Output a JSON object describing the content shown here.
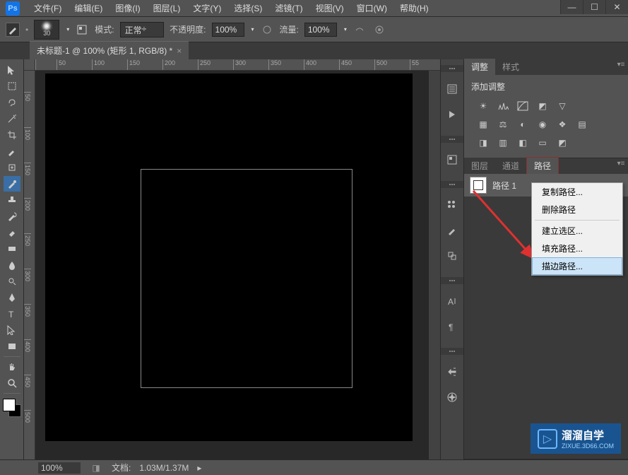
{
  "app": {
    "logo_text": "Ps"
  },
  "menubar": [
    "文件(F)",
    "编辑(E)",
    "图像(I)",
    "图层(L)",
    "文字(Y)",
    "选择(S)",
    "滤镜(T)",
    "视图(V)",
    "窗口(W)",
    "帮助(H)"
  ],
  "window_controls": {
    "minimize": "—",
    "maximize": "☐",
    "close": "✕"
  },
  "options_bar": {
    "brush_size": "30",
    "mode_label": "模式:",
    "mode_value": "正常",
    "opacity_label": "不透明度:",
    "opacity_value": "100%",
    "flow_label": "流量:",
    "flow_value": "100%"
  },
  "document": {
    "tab_title": "未标题-1 @ 100% (矩形 1, RGB/8) *",
    "close": "×"
  },
  "ruler_h": [
    "50",
    "100",
    "150",
    "200",
    "250",
    "300",
    "350",
    "400",
    "450",
    "500",
    "55"
  ],
  "ruler_v": [
    "50",
    "100",
    "150",
    "200",
    "250",
    "300",
    "350",
    "400",
    "450",
    "500"
  ],
  "panels": {
    "adjustments_tab": "调整",
    "styles_tab": "样式",
    "adjustments_subtitle": "添加调整",
    "layers_tab": "图层",
    "channels_tab": "通道",
    "paths_tab": "路径",
    "path_item_name": "路径 1"
  },
  "context_menu": {
    "items": [
      "复制路径...",
      "删除路径",
      "建立选区...",
      "填充路径...",
      "描边路径..."
    ]
  },
  "statusbar": {
    "zoom": "100%",
    "doc_label": "文档:",
    "doc_value": "1.03M/1.37M"
  },
  "watermark": {
    "main": "溜溜自学",
    "sub": "ZIXUE.3D66.COM"
  }
}
